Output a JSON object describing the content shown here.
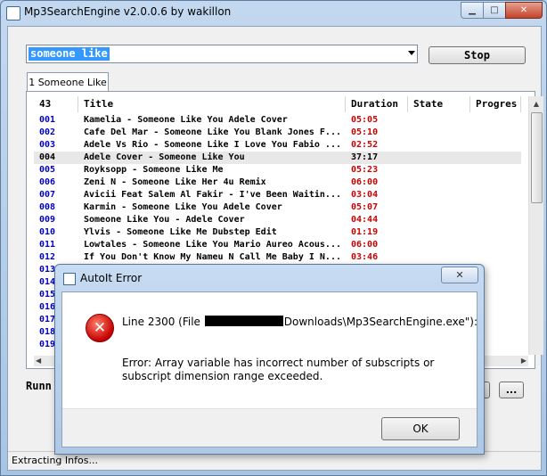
{
  "window": {
    "title": "Mp3SearchEngine v2.0.0.6 by wakillon",
    "minimize": "▁",
    "maximize": "□",
    "close": "✕"
  },
  "search": {
    "value": "someone like",
    "stop_label": "Stop"
  },
  "tab": {
    "label": "1 Someone Like"
  },
  "list": {
    "columns": [
      "43",
      "Title",
      "Duration",
      "State",
      "Progres"
    ],
    "rows": [
      [
        "001",
        "Kamelia - Someone Like You Adele Cover",
        "05:05"
      ],
      [
        "002",
        "Cafe Del Mar - Someone Like You Blank Jones F...",
        "05:10"
      ],
      [
        "003",
        "Adele Vs Rio - Someone Like I Love You Fabio ...",
        "02:52"
      ],
      [
        "004",
        "Adele Cover - Someone Like You",
        "37:17"
      ],
      [
        "005",
        "Royksopp - Someone Like Me",
        "05:23"
      ],
      [
        "006",
        "Zeni N - Someone Like Her 4u Remix",
        "06:00"
      ],
      [
        "007",
        "Avicii Feat Salem Al Fakir - I've Been Waitin...",
        "03:04"
      ],
      [
        "008",
        "Karmin - Someone Like You Adele Cover",
        "05:07"
      ],
      [
        "009",
        "Someone Like You - Adele Cover",
        "04:44"
      ],
      [
        "010",
        "Ylvis - Someone Like Me Dubstep Edit",
        "01:19"
      ],
      [
        "011",
        "Lowtales - Someone Like You Mario Aureo Acous...",
        "06:00"
      ],
      [
        "012",
        "If You Don't Know My Nameu N Call Me Baby I N...",
        "03:46"
      ],
      [
        "013",
        "",
        ""
      ],
      [
        "014",
        "",
        ""
      ],
      [
        "015",
        "",
        ""
      ],
      [
        "016",
        "",
        ""
      ],
      [
        "017",
        "",
        ""
      ],
      [
        "018",
        "",
        ""
      ],
      [
        "019",
        "",
        ""
      ]
    ],
    "selected_index": 3
  },
  "running_label": "Runn",
  "dots_label": "...",
  "status": "Extracting Infos...",
  "dialog": {
    "title": "AutoIt Error",
    "close": "✕",
    "line1_prefix": "Line 2300  (File",
    "line1_suffix": "Downloads\\Mp3SearchEngine.exe\"):",
    "message": "Error: Array variable has incorrect number of subscripts or subscript dimension range exceeded.",
    "ok_label": "OK",
    "icon": "error-x-icon"
  }
}
